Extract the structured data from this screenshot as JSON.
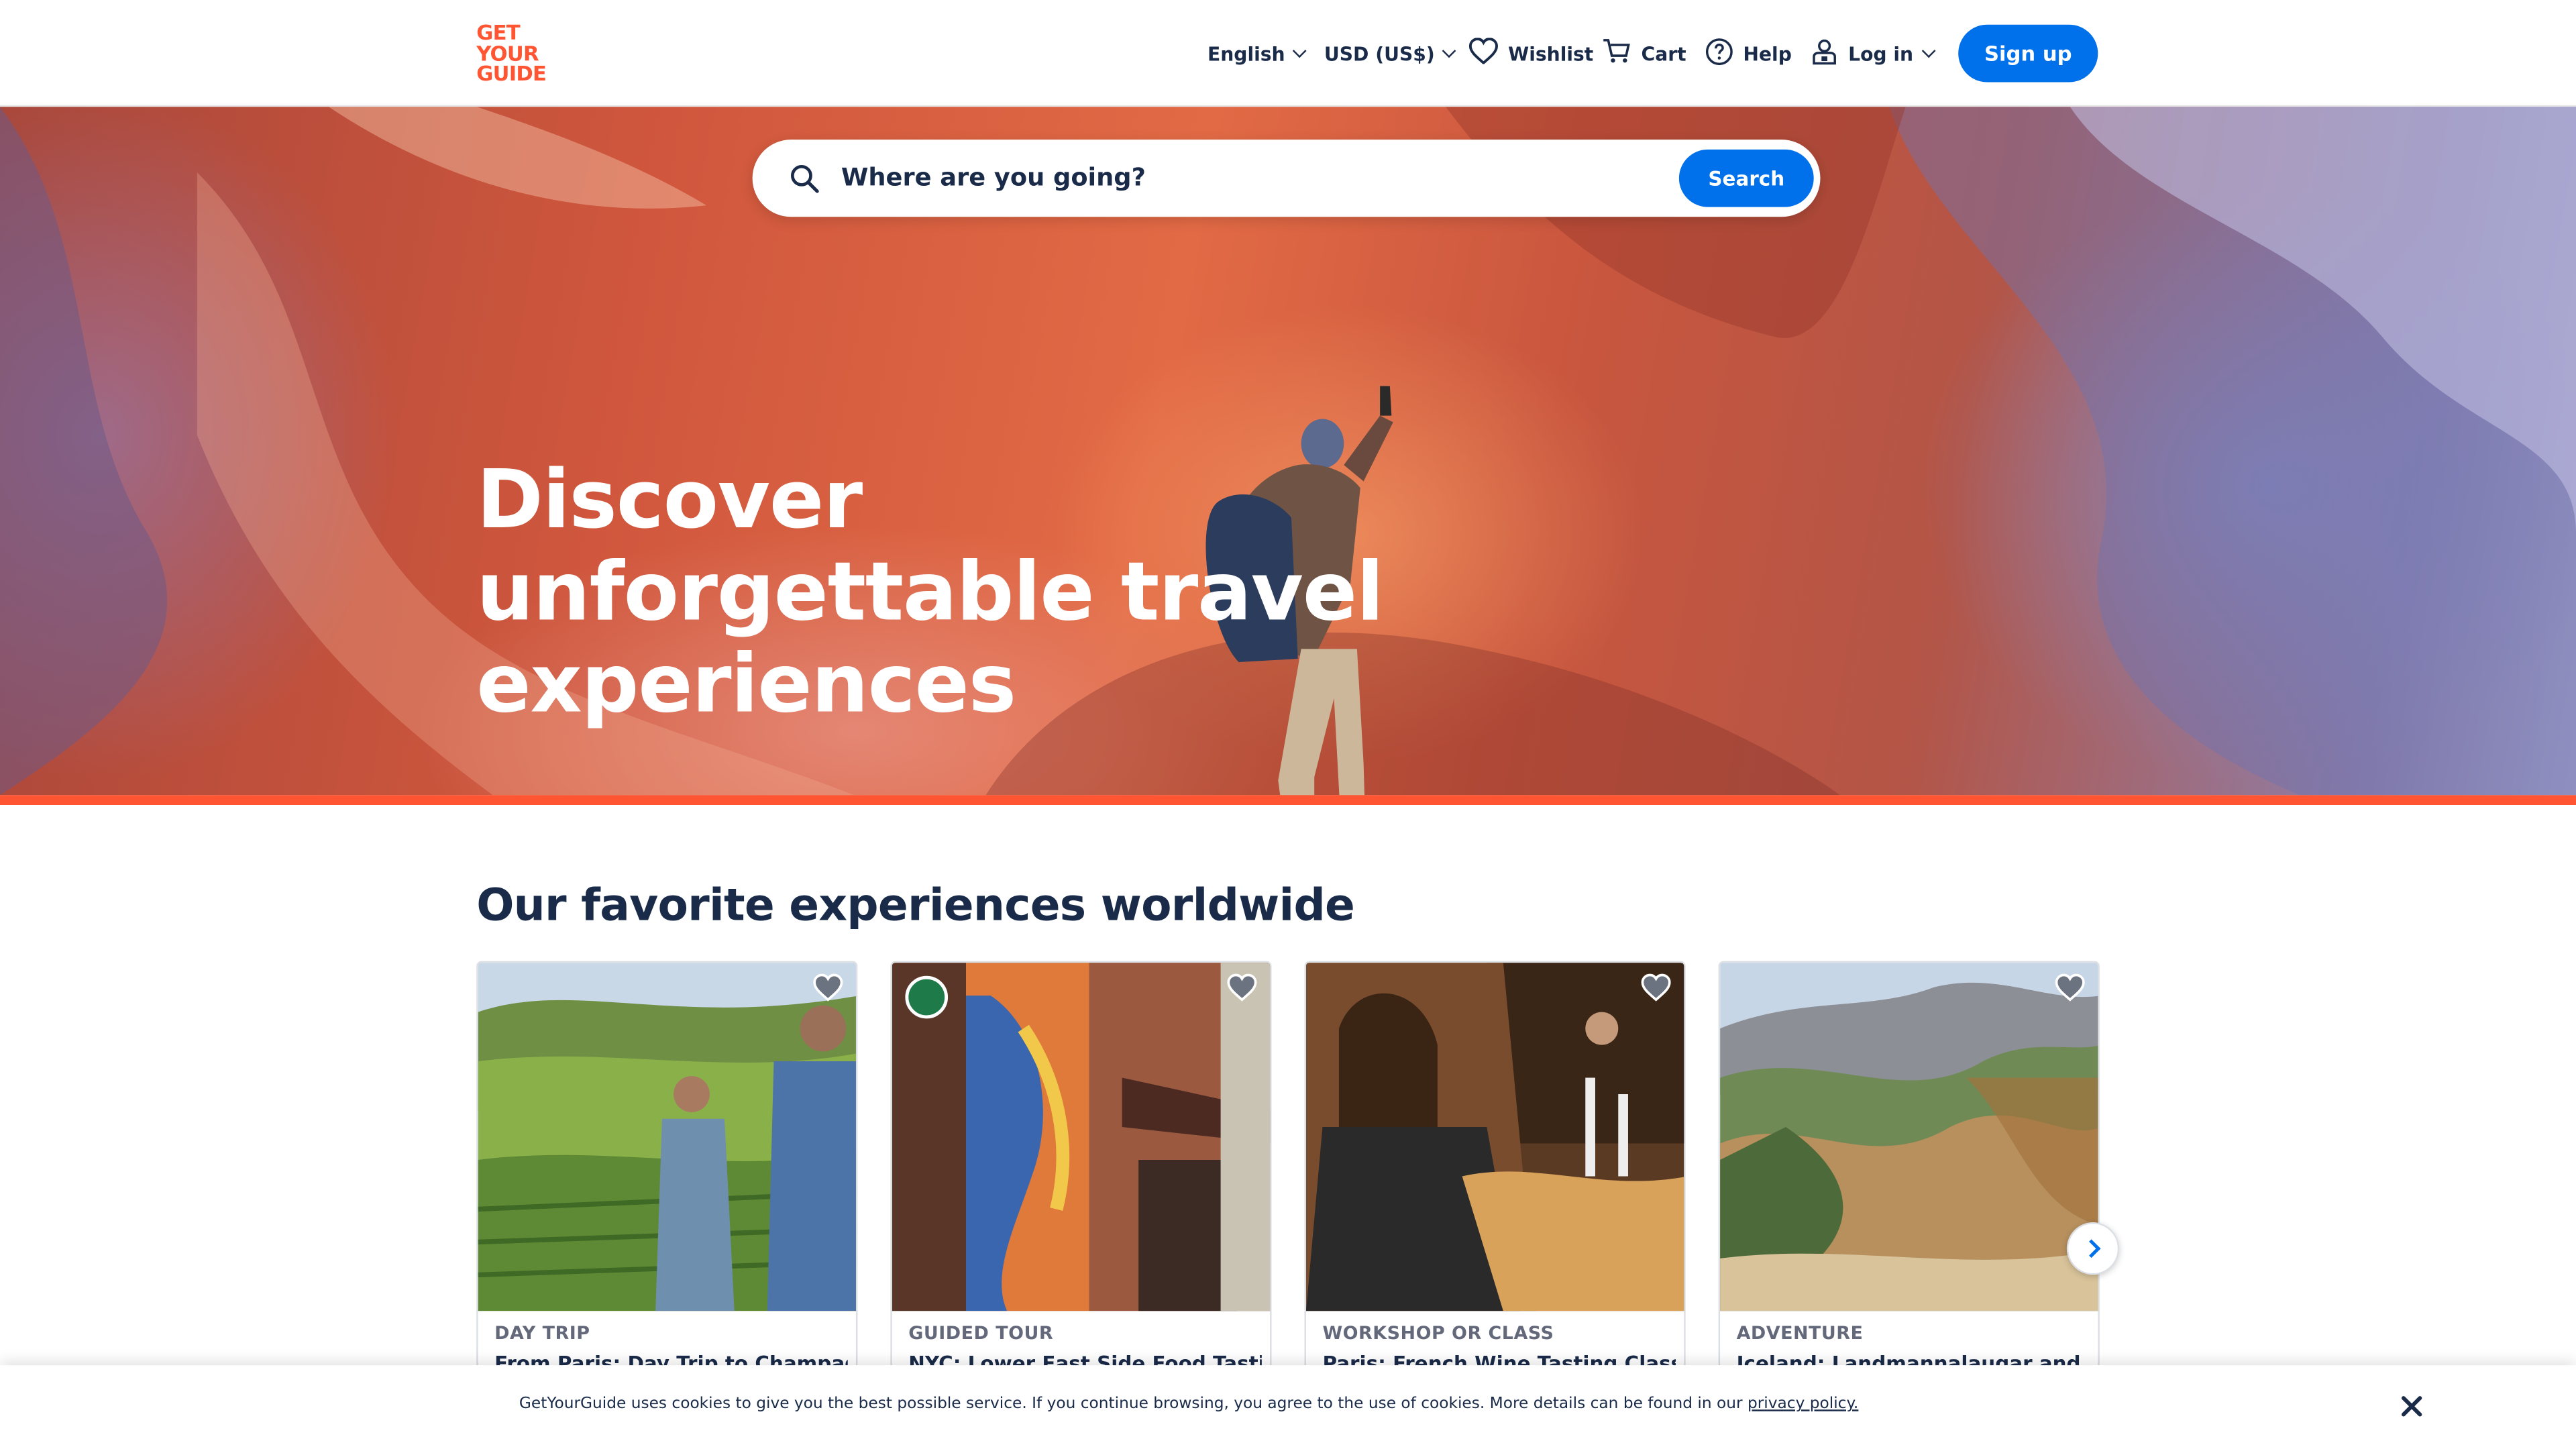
{
  "header": {
    "logo_lines": [
      "GET",
      "YOUR",
      "GUIDE"
    ],
    "language": "English",
    "currency": "USD (US$)",
    "wishlist": "Wishlist",
    "cart": "Cart",
    "help": "Help",
    "login": "Log in",
    "signup": "Sign up"
  },
  "search": {
    "placeholder": "Where are you going?",
    "button": "Search"
  },
  "hero": {
    "headline": "Discover unforgettable travel experiences"
  },
  "experiences": {
    "title": "Our favorite experiences worldwide",
    "cards": [
      {
        "category": "DAY TRIP",
        "title": "From Paris: Day Trip to Champagne"
      },
      {
        "category": "GUIDED TOUR",
        "title": "NYC: Lower East Side Food Tastings"
      },
      {
        "category": "WORKSHOP OR CLASS",
        "title": "Paris: French Wine Tasting Class with"
      },
      {
        "category": "ADVENTURE",
        "title": "Iceland: Landmannalaugar and"
      }
    ]
  },
  "cookie": {
    "text": "GetYourGuide uses cookies to give you the best possible service. If you continue browsing, you agree to the use of cookies. More details can be found in our",
    "link": "privacy policy."
  },
  "colors": {
    "brand": "#ff5533",
    "primary": "#0071eb",
    "text": "#1a2b49"
  }
}
